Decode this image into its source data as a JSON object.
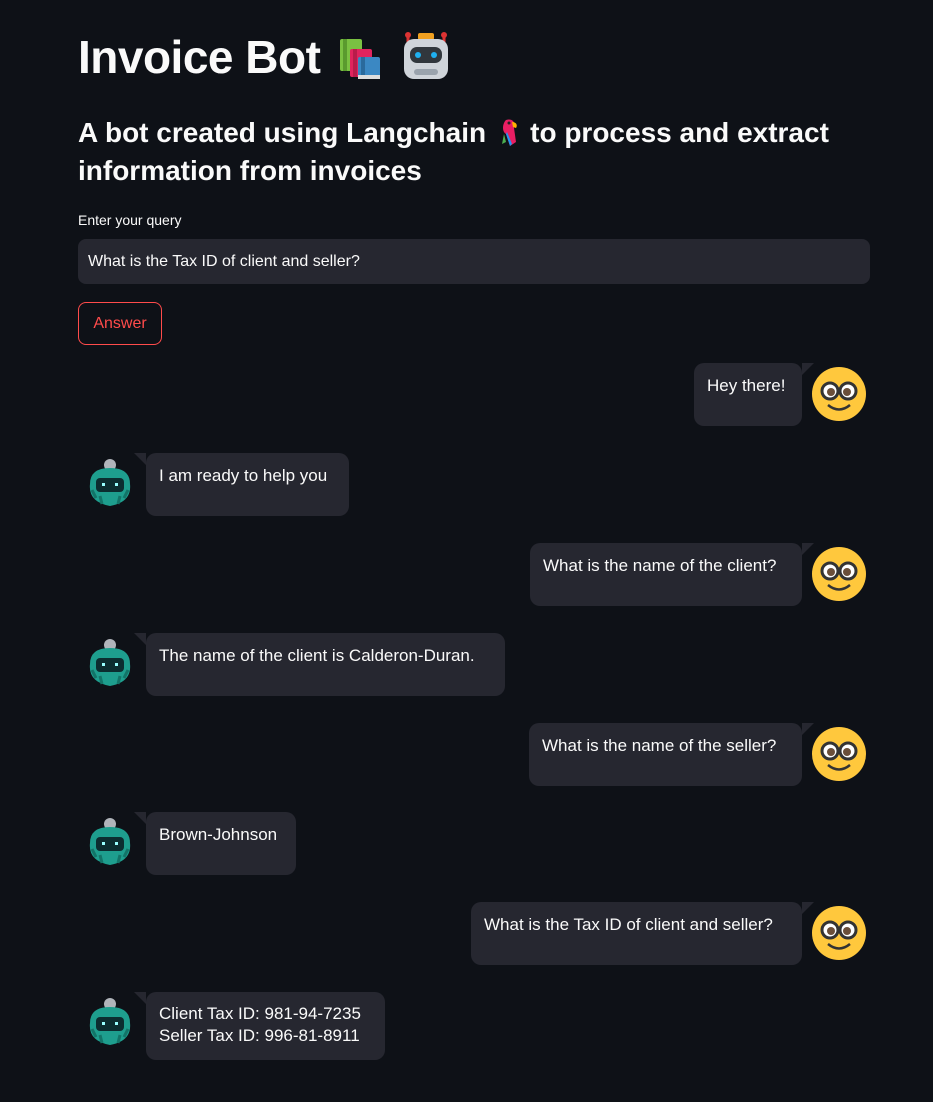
{
  "header": {
    "title": "Invoice Bot",
    "title_icons": [
      "books-icon",
      "robot-icon"
    ],
    "subtitle_before": "A bot created using Langchain",
    "subtitle_icon": "parrot-icon",
    "subtitle_after": "to process and extract information from invoices"
  },
  "query": {
    "label": "Enter your query",
    "value": "What is the Tax ID of client and seller?"
  },
  "answer_button": {
    "label": "Answer",
    "color": "#ff4b4b"
  },
  "colors": {
    "background": "#0e1117",
    "bubble": "#262730",
    "text": "#fafafa"
  },
  "messages": [
    {
      "role": "user",
      "text": "Hey there!"
    },
    {
      "role": "bot",
      "text": "I am ready to help you"
    },
    {
      "role": "user",
      "text": "What is the name of the client?"
    },
    {
      "role": "bot",
      "text": "The name of the client is Calderon-Duran."
    },
    {
      "role": "user",
      "text": "What is the name of the seller?"
    },
    {
      "role": "bot",
      "text": "Brown-Johnson"
    },
    {
      "role": "user",
      "text": "What is the Tax ID of client and seller?"
    },
    {
      "role": "bot",
      "text": "Client Tax ID: 981-94-7235\nSeller Tax ID: 996-81-8911"
    }
  ]
}
